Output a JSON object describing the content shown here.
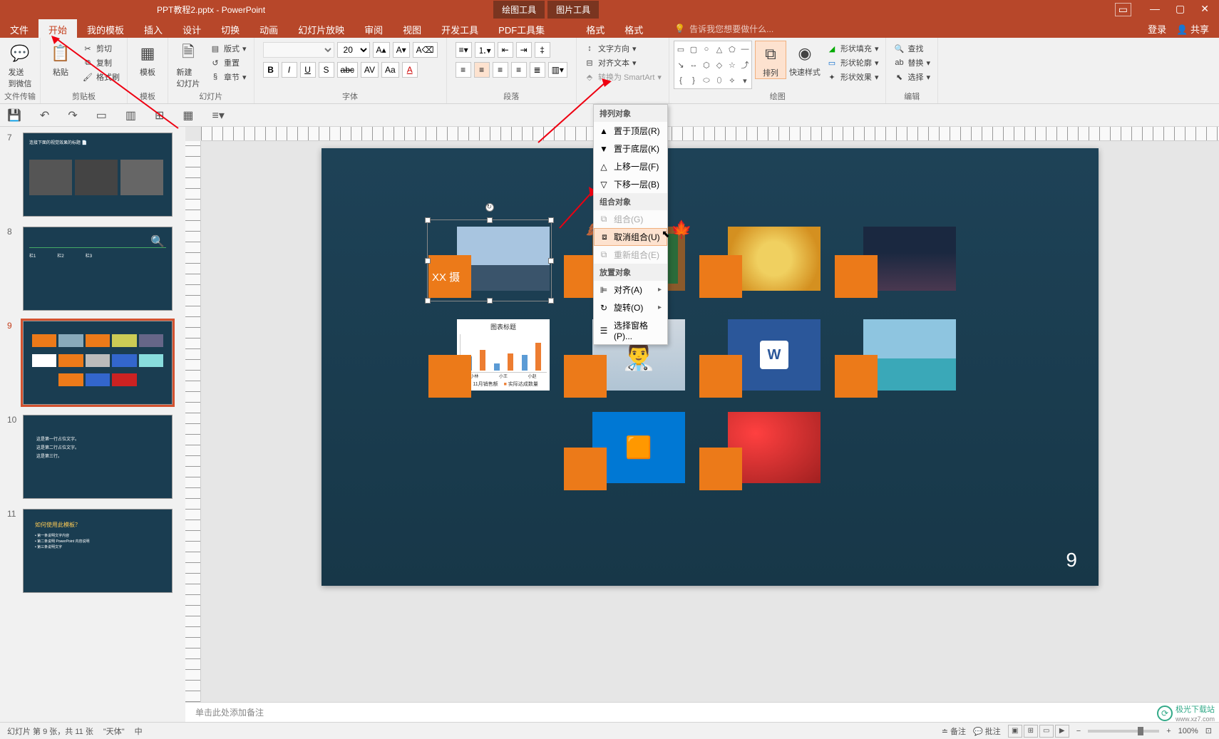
{
  "title": "PPT教程2.pptx - PowerPoint",
  "contextualTabs": [
    "绘图工具",
    "图片工具"
  ],
  "tabs": {
    "file": "文件",
    "home": "开始",
    "myTemplate": "我的模板",
    "insert": "插入",
    "design": "设计",
    "transitions": "切换",
    "animations": "动画",
    "slideshow": "幻灯片放映",
    "review": "审阅",
    "view": "视图",
    "developer": "开发工具",
    "pdf": "PDF工具集",
    "format1": "格式",
    "format2": "格式"
  },
  "tellMe": "告诉我您想要做什么...",
  "signIn": "登录",
  "share": "共享",
  "ribbon": {
    "sendWechat": "发送\n到微信",
    "paste": "粘贴",
    "cut": "剪切",
    "copy": "复制",
    "formatPainter": "格式刷",
    "groupClipboard": "剪贴板",
    "groupFileTransfer": "文件传输",
    "template": "模板",
    "groupTemplate": "模板",
    "newSlide": "新建\n幻灯片",
    "layout": "版式",
    "reset": "重置",
    "section": "章节",
    "groupSlides": "幻灯片",
    "fontSize": "20",
    "groupFont": "字体",
    "groupParagraph": "段落",
    "textDirection": "文字方向",
    "alignText": "对齐文本",
    "smartArt": "转换为 SmartArt",
    "arrange": "排列",
    "quickStyles": "快速样式",
    "shapeFill": "形状填充",
    "shapeOutline": "形状轮廓",
    "shapeEffects": "形状效果",
    "groupDrawing": "绘图",
    "find": "查找",
    "replace": "替换",
    "select": "选择",
    "groupEditing": "编辑"
  },
  "arrangeMenu": {
    "headerOrder": "排列对象",
    "bringFront": "置于顶层(R)",
    "sendBack": "置于底层(K)",
    "bringForward": "上移一层(F)",
    "sendBackward": "下移一层(B)",
    "headerGroup": "组合对象",
    "group": "组合(G)",
    "ungroup": "取消组合(U)",
    "regroup": "重新组合(E)",
    "headerPosition": "放置对象",
    "align": "对齐(A)",
    "rotate": "旋转(O)",
    "selectionPane": "选择窗格(P)..."
  },
  "thumbs": [
    "7",
    "8",
    "9",
    "10",
    "11"
  ],
  "slide": {
    "xxLabel": "XX 摄",
    "pageNum": "9",
    "chartTitle": "图表标题",
    "chartCats": [
      "小林",
      "小王",
      "小赵"
    ],
    "chartLegend": [
      "11月销售额",
      "实际达成数量"
    ]
  },
  "notes": "单击此处添加备注",
  "status": {
    "slideInfo": "幻灯片 第 9 张，共 11 张",
    "theme": "\"天体\"",
    "lang": "中",
    "notes": "备注",
    "comments": "批注",
    "zoom": "100%"
  },
  "watermark": "极光下载站",
  "watermarkUrl": "www.xz7.com",
  "chart_data": {
    "type": "bar",
    "title": "图表标题",
    "categories": [
      "小林",
      "小王",
      "小赵"
    ],
    "series": [
      {
        "name": "11月销售额",
        "values": [
          3,
          1,
          3
        ]
      },
      {
        "name": "实际达成数量",
        "values": [
          4,
          3,
          5
        ]
      }
    ],
    "ylim": [
      0,
      5
    ]
  }
}
